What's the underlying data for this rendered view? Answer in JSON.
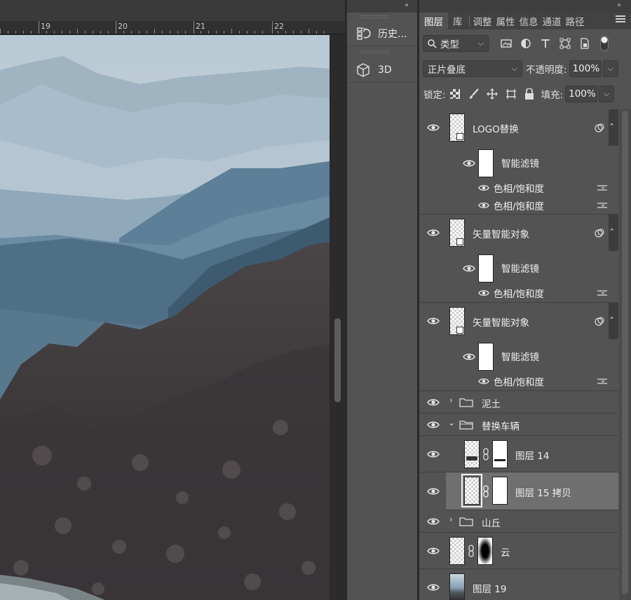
{
  "ruler": {
    "labels": [
      "19",
      "20",
      "21",
      "22"
    ]
  },
  "top_chevrons": {
    "left_panel": "‹‹",
    "right_panel": "››"
  },
  "narrow_panel": {
    "items": [
      {
        "icon": "history-brush-icon",
        "label": "历史..."
      },
      {
        "icon": "cube-3d-icon",
        "label": "3D"
      }
    ]
  },
  "layers_panel": {
    "tabs": [
      {
        "label": "图层",
        "active": true
      },
      {
        "label": "库",
        "active": false
      },
      {
        "label": "调整",
        "active": false
      },
      {
        "label": "属性",
        "active": false
      },
      {
        "label": "信息",
        "active": false
      },
      {
        "label": "通道",
        "active": false
      },
      {
        "label": "路径",
        "active": false
      }
    ],
    "filter": {
      "selected": "类型",
      "icons": [
        "image-filter-icon",
        "adjustment-filter-icon",
        "type-filter-icon",
        "shape-filter-icon",
        "smart-object-filter-icon"
      ]
    },
    "blend_mode": "正片叠底",
    "opacity_label": "不透明度:",
    "opacity_value": "100%",
    "lock_label": "锁定:",
    "fill_label": "填充:",
    "fill_value": "100%",
    "layers": [
      {
        "type": "smart",
        "name": "LOGO替换",
        "filters_label": "智能滤镜",
        "filters": [
          "色相/饱和度",
          "色相/饱和度"
        ]
      },
      {
        "type": "smart",
        "name": "矢量智能对象",
        "filters_label": "智能滤镜",
        "filters": [
          "色相/饱和度"
        ]
      },
      {
        "type": "smart",
        "name": "矢量智能对象",
        "filters_label": "智能滤镜",
        "filters": [
          "色相/饱和度"
        ]
      },
      {
        "type": "group",
        "name": "泥土",
        "expanded": false
      },
      {
        "type": "group",
        "name": "替换车辆",
        "expanded": true
      },
      {
        "type": "masked",
        "name": "图层 14",
        "selected": false
      },
      {
        "type": "masked",
        "name": "图层 15 拷贝",
        "selected": true
      },
      {
        "type": "group",
        "name": "山丘",
        "expanded": false
      },
      {
        "type": "masked",
        "name": "云",
        "selected": false
      },
      {
        "type": "image",
        "name": "图层 19",
        "selected": false
      }
    ]
  },
  "colors": {
    "panel_bg": "#535353",
    "selected_row": "#6f6f6f",
    "canvas_bg": "#282828"
  }
}
